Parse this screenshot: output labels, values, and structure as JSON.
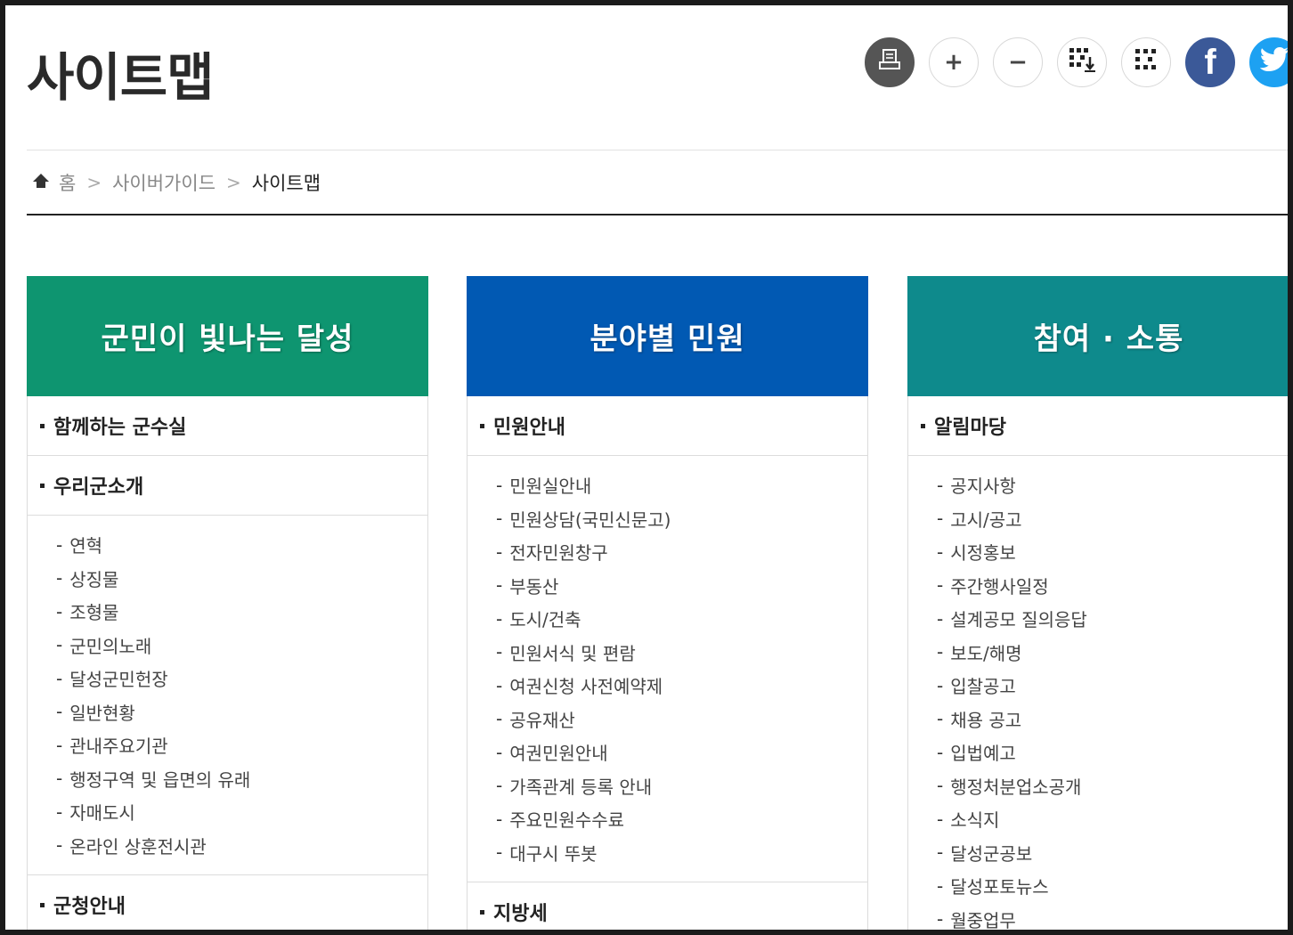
{
  "page_title": "사이트맵",
  "toolbar": {
    "print_icon": "print-icon",
    "zoom_in": "+",
    "zoom_out": "−",
    "qr_download_icon": "qr-download-icon",
    "qr_icon": "qr-icon",
    "facebook": "f",
    "twitter_icon": "twitter-bird-icon",
    "colors": {
      "print": "#555555",
      "facebook": "#3b5998",
      "twitter": "#1da1f2"
    }
  },
  "breadcrumb": {
    "home": "홈",
    "items": [
      "사이버가이드",
      "사이트맵"
    ]
  },
  "columns": [
    {
      "title": "군민이 빛나는 달성",
      "color": "#0e9570",
      "sections": [
        {
          "title": "함께하는 군수실",
          "items": []
        },
        {
          "title": "우리군소개",
          "items": [
            "연혁",
            "상징물",
            "조형물",
            "군민의노래",
            "달성군민헌장",
            "일반현황",
            "관내주요기관",
            "행정구역 및 읍면의 유래",
            "자매도시",
            "온라인 상훈전시관"
          ]
        },
        {
          "title": "군청안내",
          "items": []
        }
      ]
    },
    {
      "title": "분야별 민원",
      "color": "#0159b3",
      "sections": [
        {
          "title": "민원안내",
          "items": [
            "민원실안내",
            "민원상담(국민신문고)",
            "전자민원창구",
            "부동산",
            "도시/건축",
            "민원서식 및 편람",
            "여권신청 사전예약제",
            "공유재산",
            "여권민원안내",
            "가족관계 등록 안내",
            "주요민원수수료",
            "대구시 뚜봇"
          ]
        },
        {
          "title": "지방세",
          "items": []
        }
      ]
    },
    {
      "title": "참여 · 소통",
      "color": "#0e8a8c",
      "sections": [
        {
          "title": "알림마당",
          "items": [
            "공지사항",
            "고시/공고",
            "시정홍보",
            "주간행사일정",
            "설계공모 질의응답",
            "보도/해명",
            "입찰공고",
            "채용 공고",
            "입법예고",
            "행정처분업소공개",
            "소식지",
            "달성군공보",
            "달성포토뉴스",
            "월중업무"
          ]
        }
      ]
    }
  ]
}
